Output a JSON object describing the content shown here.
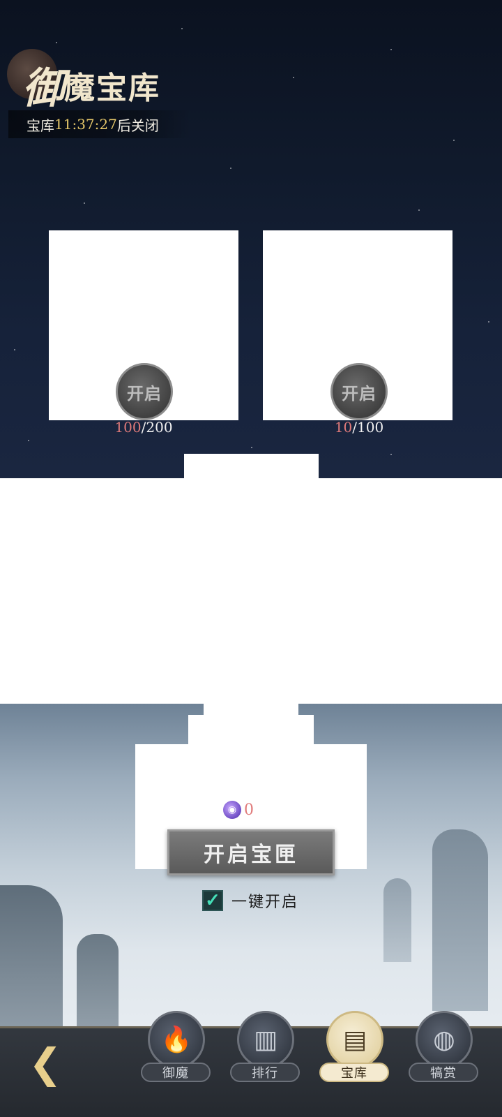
{
  "header": {
    "title_first": "御",
    "title_rest": "魔宝库",
    "timer_prefix": "宝库",
    "timer_time": "11:37:27",
    "timer_suffix": "后关闭"
  },
  "chests": [
    {
      "button_label": "开启",
      "current": "100",
      "total": "/200"
    },
    {
      "button_label": "开启",
      "current": "10",
      "total": "/100"
    }
  ],
  "bottom_panel": {
    "token_count": "0",
    "token_icon": "purple-orb-icon",
    "open_button_label": "开启宝匣",
    "one_key_label": "一键开启",
    "one_key_checked": true
  },
  "nav": {
    "back_icon": "back-arrow-icon",
    "items": [
      {
        "label": "御魔",
        "icon": "flame-icon",
        "active": false
      },
      {
        "label": "排行",
        "icon": "ranking-scroll-icon",
        "active": false
      },
      {
        "label": "宝库",
        "icon": "treasure-chest-icon",
        "active": true
      },
      {
        "label": "犒赏",
        "icon": "money-bag-icon",
        "active": false
      }
    ]
  }
}
